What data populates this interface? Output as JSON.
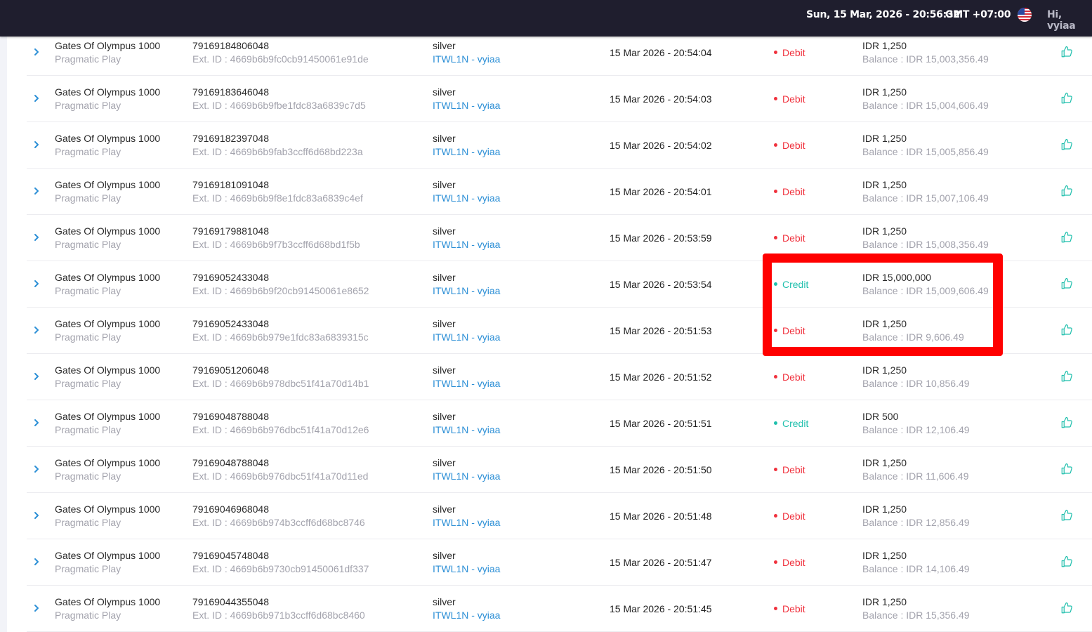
{
  "header": {
    "datetime": "Sun, 15 Mar, 2026 - 20:56:32",
    "timezone": "GMT +07:00",
    "greeting": "Hi, vyiaa",
    "flag_icon": "us-flag-icon"
  },
  "colors": {
    "topbar": "#1f1e2e",
    "debit": "#f0313d",
    "credit": "#1ebfac",
    "link": "#2c8fd6",
    "highlight": "#ff0000"
  },
  "transactions": [
    {
      "game": "Gates Of Olympus 1000",
      "provider": "Pragmatic Play",
      "tx_id": "79169184806048",
      "ext_id": "Ext. ID : 4669b6b9fc0cb91450061e91de",
      "tier": "silver",
      "account": "ITWL1N - vyiaa",
      "time": "15 Mar 2026 - 20:54:04",
      "type": "Debit",
      "amount": "IDR 1,250",
      "balance": "Balance : IDR 15,003,356.49"
    },
    {
      "game": "Gates Of Olympus 1000",
      "provider": "Pragmatic Play",
      "tx_id": "79169183646048",
      "ext_id": "Ext. ID : 4669b6b9fbe1fdc83a6839c7d5",
      "tier": "silver",
      "account": "ITWL1N - vyiaa",
      "time": "15 Mar 2026 - 20:54:03",
      "type": "Debit",
      "amount": "IDR 1,250",
      "balance": "Balance : IDR 15,004,606.49"
    },
    {
      "game": "Gates Of Olympus 1000",
      "provider": "Pragmatic Play",
      "tx_id": "79169182397048",
      "ext_id": "Ext. ID : 4669b6b9fab3ccff6d68bd223a",
      "tier": "silver",
      "account": "ITWL1N - vyiaa",
      "time": "15 Mar 2026 - 20:54:02",
      "type": "Debit",
      "amount": "IDR 1,250",
      "balance": "Balance : IDR 15,005,856.49"
    },
    {
      "game": "Gates Of Olympus 1000",
      "provider": "Pragmatic Play",
      "tx_id": "79169181091048",
      "ext_id": "Ext. ID : 4669b6b9f8e1fdc83a6839c4ef",
      "tier": "silver",
      "account": "ITWL1N - vyiaa",
      "time": "15 Mar 2026 - 20:54:01",
      "type": "Debit",
      "amount": "IDR 1,250",
      "balance": "Balance : IDR 15,007,106.49"
    },
    {
      "game": "Gates Of Olympus 1000",
      "provider": "Pragmatic Play",
      "tx_id": "79169179881048",
      "ext_id": "Ext. ID : 4669b6b9f7b3ccff6d68bd1f5b",
      "tier": "silver",
      "account": "ITWL1N - vyiaa",
      "time": "15 Mar 2026 - 20:53:59",
      "type": "Debit",
      "amount": "IDR 1,250",
      "balance": "Balance : IDR 15,008,356.49"
    },
    {
      "game": "Gates Of Olympus 1000",
      "provider": "Pragmatic Play",
      "tx_id": "79169052433048",
      "ext_id": "Ext. ID : 4669b6b9f20cb91450061e8652",
      "tier": "silver",
      "account": "ITWL1N - vyiaa",
      "time": "15 Mar 2026 - 20:53:54",
      "type": "Credit",
      "amount": "IDR 15,000,000",
      "balance": "Balance : IDR 15,009,606.49"
    },
    {
      "game": "Gates Of Olympus 1000",
      "provider": "Pragmatic Play",
      "tx_id": "79169052433048",
      "ext_id": "Ext. ID : 4669b6b979e1fdc83a6839315c",
      "tier": "silver",
      "account": "ITWL1N - vyiaa",
      "time": "15 Mar 2026 - 20:51:53",
      "type": "Debit",
      "amount": "IDR 1,250",
      "balance": "Balance : IDR 9,606.49"
    },
    {
      "game": "Gates Of Olympus 1000",
      "provider": "Pragmatic Play",
      "tx_id": "79169051206048",
      "ext_id": "Ext. ID : 4669b6b978dbc51f41a70d14b1",
      "tier": "silver",
      "account": "ITWL1N - vyiaa",
      "time": "15 Mar 2026 - 20:51:52",
      "type": "Debit",
      "amount": "IDR 1,250",
      "balance": "Balance : IDR 10,856.49"
    },
    {
      "game": "Gates Of Olympus 1000",
      "provider": "Pragmatic Play",
      "tx_id": "79169048788048",
      "ext_id": "Ext. ID : 4669b6b976dbc51f41a70d12e6",
      "tier": "silver",
      "account": "ITWL1N - vyiaa",
      "time": "15 Mar 2026 - 20:51:51",
      "type": "Credit",
      "amount": "IDR 500",
      "balance": "Balance : IDR 12,106.49"
    },
    {
      "game": "Gates Of Olympus 1000",
      "provider": "Pragmatic Play",
      "tx_id": "79169048788048",
      "ext_id": "Ext. ID : 4669b6b976dbc51f41a70d11ed",
      "tier": "silver",
      "account": "ITWL1N - vyiaa",
      "time": "15 Mar 2026 - 20:51:50",
      "type": "Debit",
      "amount": "IDR 1,250",
      "balance": "Balance : IDR 11,606.49"
    },
    {
      "game": "Gates Of Olympus 1000",
      "provider": "Pragmatic Play",
      "tx_id": "79169046968048",
      "ext_id": "Ext. ID : 4669b6b974b3ccff6d68bc8746",
      "tier": "silver",
      "account": "ITWL1N - vyiaa",
      "time": "15 Mar 2026 - 20:51:48",
      "type": "Debit",
      "amount": "IDR 1,250",
      "balance": "Balance : IDR 12,856.49"
    },
    {
      "game": "Gates Of Olympus 1000",
      "provider": "Pragmatic Play",
      "tx_id": "79169045748048",
      "ext_id": "Ext. ID : 4669b6b9730cb91450061df337",
      "tier": "silver",
      "account": "ITWL1N - vyiaa",
      "time": "15 Mar 2026 - 20:51:47",
      "type": "Debit",
      "amount": "IDR 1,250",
      "balance": "Balance : IDR 14,106.49"
    },
    {
      "game": "Gates Of Olympus 1000",
      "provider": "Pragmatic Play",
      "tx_id": "79169044355048",
      "ext_id": "Ext. ID : 4669b6b971b3ccff6d68bc8460",
      "tier": "silver",
      "account": "ITWL1N - vyiaa",
      "time": "15 Mar 2026 - 20:51:45",
      "type": "Debit",
      "amount": "IDR 1,250",
      "balance": "Balance : IDR 15,356.49"
    }
  ]
}
